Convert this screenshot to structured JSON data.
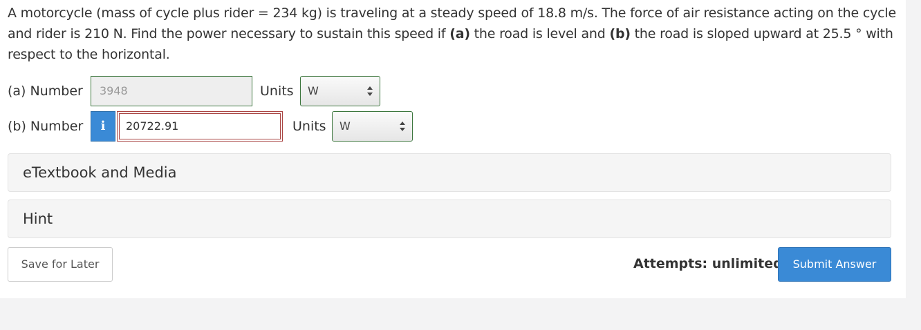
{
  "question": {
    "part1": "A motorcycle (mass of cycle plus rider = 234 kg) is traveling at a steady speed of 18.8 m/s. The force of air resistance acting on the cycle and rider is 210 N. Find the power necessary to sustain this speed if ",
    "a_marker": "(a)",
    "part2": " the road is level and ",
    "b_marker": "(b)",
    "part3": " the road is sloped upward at 25.5 ° with respect to the horizontal."
  },
  "part_a": {
    "label": "(a) Number",
    "value": "3948",
    "units_label": "Units",
    "units_value": "W"
  },
  "part_b": {
    "label": "(b) Number",
    "info_glyph": "i",
    "value": "20722.91",
    "units_label": "Units",
    "units_value": "W"
  },
  "panels": {
    "etextbook": "eTextbook and Media",
    "hint": "Hint"
  },
  "footer": {
    "save_label": "Save for Later",
    "attempts_text": "Attempts: unlimited",
    "submit_label": "Submit Answer"
  },
  "colors": {
    "correct_border": "#3c763d",
    "incorrect_border": "#a94442",
    "primary_blue": "#3a8ad6"
  }
}
